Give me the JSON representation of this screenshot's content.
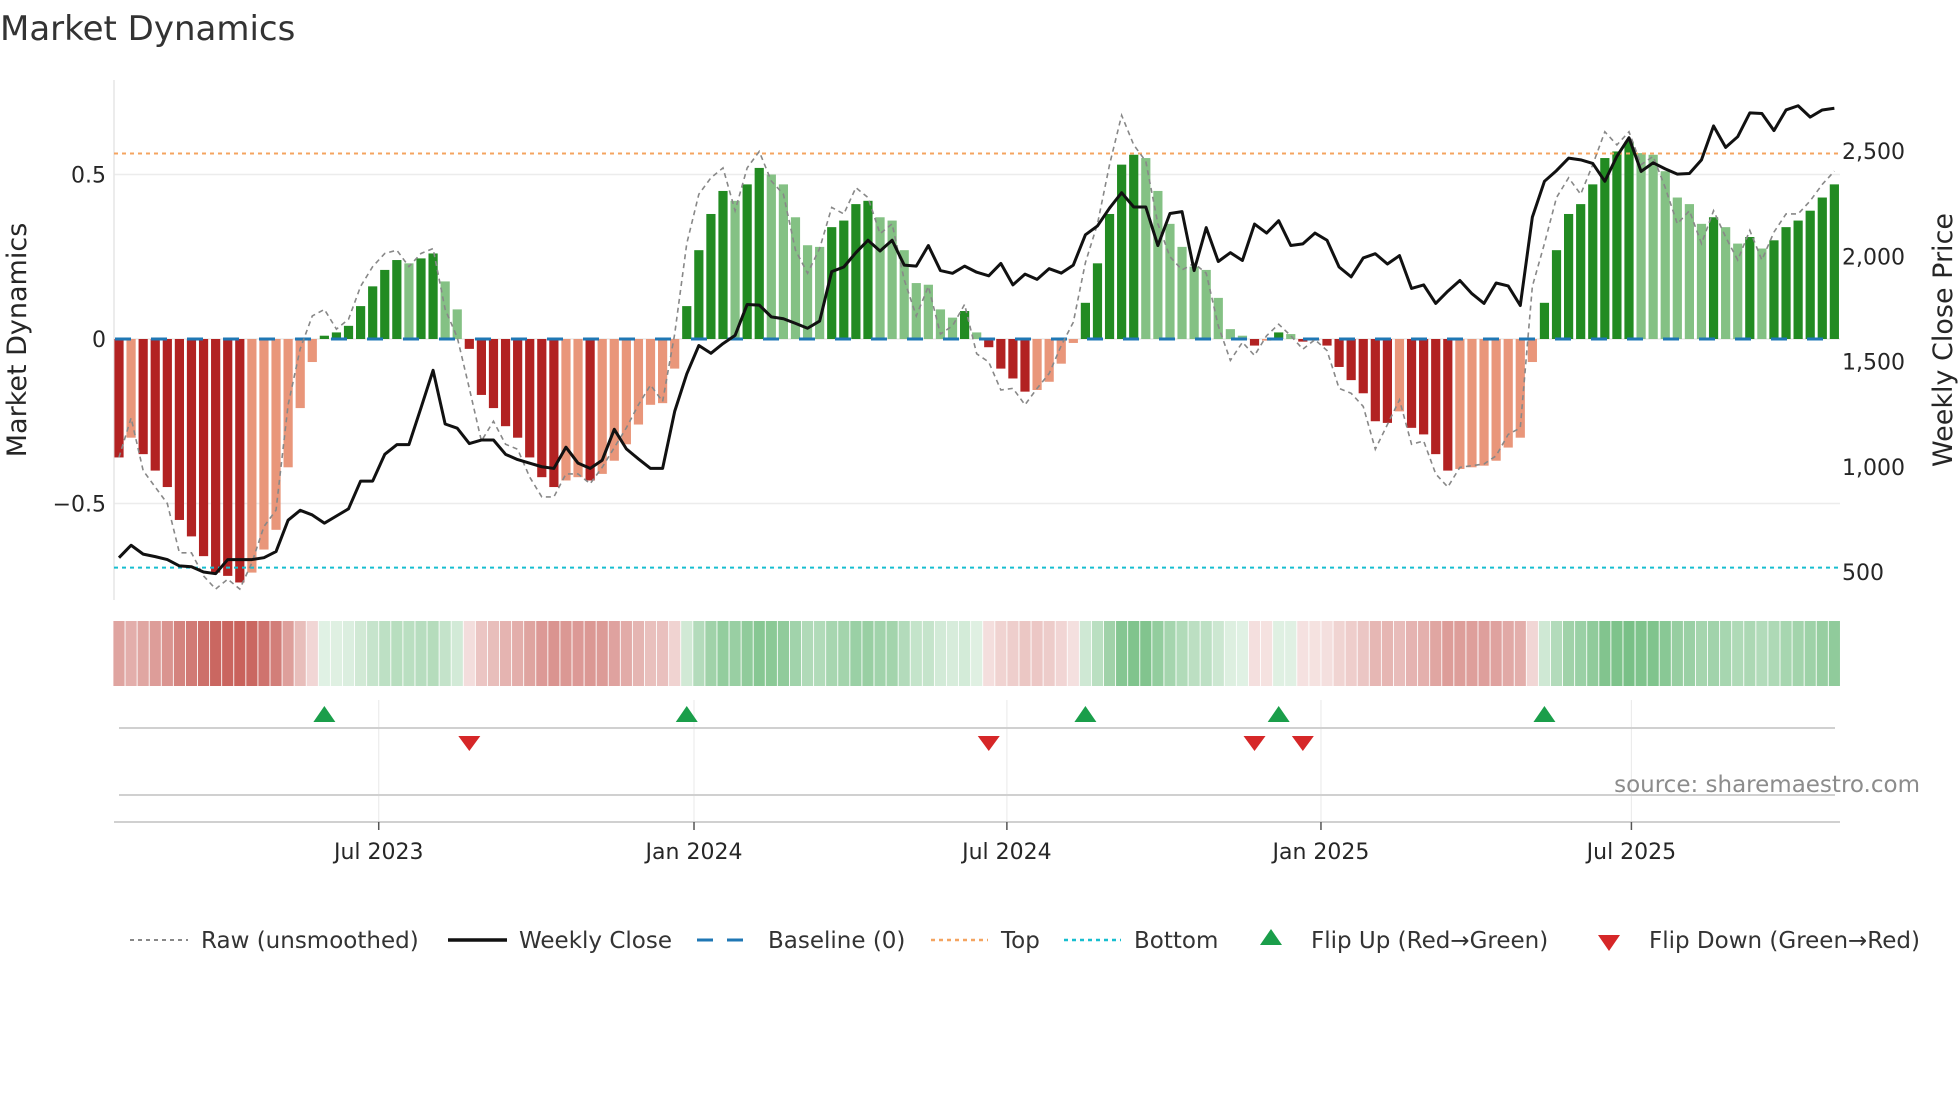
{
  "title": "Market Dynamics",
  "source": "source: sharemaestro.com",
  "colors": {
    "neg_strong": "#b22222",
    "neg_weak": "#e9967a",
    "pos_strong": "#228b22",
    "pos_weak": "#84c184",
    "close": "#111111",
    "raw": "#888888",
    "baseline": "#1f77b4",
    "top": "#f4a460",
    "bottom": "#17becf",
    "flip_up": "#1a9e4a",
    "flip_down": "#d62728"
  },
  "chart_data": {
    "type": "bar",
    "title": "Market Dynamics",
    "xlabel": "",
    "ylabel": "Market Dynamics",
    "ylabel_right": "Weekly Close Price",
    "ylim": [
      -0.79,
      0.79
    ],
    "ylim_right": [
      230,
      2900
    ],
    "x_unit": "week index",
    "x_ticks": [
      {
        "label": "Jul 2023",
        "x": 21.5
      },
      {
        "label": "Jan 2024",
        "x": 47.6
      },
      {
        "label": "Jul 2024",
        "x": 73.5
      },
      {
        "label": "Jan 2025",
        "x": 99.5
      },
      {
        "label": "Jul 2025",
        "x": 125.2
      }
    ],
    "y_ticks": [
      {
        "label": "0.5",
        "v": 0.5
      },
      {
        "label": "0",
        "v": 0
      },
      {
        "label": "−0.5",
        "v": -0.5
      }
    ],
    "y_ticks_right": [
      {
        "label": "2,500",
        "v": 2500
      },
      {
        "label": "2,000",
        "v": 2000
      },
      {
        "label": "1,500",
        "v": 1500
      },
      {
        "label": "1,000",
        "v": 1000
      },
      {
        "label": "500",
        "v": 500
      }
    ],
    "top_level": 0.564,
    "bottom_level": -0.695,
    "baseline": 0,
    "series": [
      {
        "name": "Market Dynamics (smoothed)",
        "values": [
          -0.36,
          -0.3,
          -0.35,
          -0.4,
          -0.45,
          -0.55,
          -0.6,
          -0.66,
          -0.71,
          -0.72,
          -0.74,
          -0.71,
          -0.64,
          -0.58,
          -0.39,
          -0.21,
          -0.07,
          0.01,
          0.02,
          0.04,
          0.1,
          0.16,
          0.21,
          0.24,
          0.23,
          0.245,
          0.26,
          0.175,
          0.09,
          -0.03,
          -0.17,
          -0.21,
          -0.265,
          -0.3,
          -0.36,
          -0.42,
          -0.45,
          -0.43,
          -0.42,
          -0.43,
          -0.41,
          -0.37,
          -0.32,
          -0.26,
          -0.2,
          -0.195,
          -0.09,
          0.1,
          0.27,
          0.38,
          0.45,
          0.42,
          0.47,
          0.52,
          0.5,
          0.47,
          0.37,
          0.285,
          0.28,
          0.34,
          0.36,
          0.41,
          0.42,
          0.37,
          0.36,
          0.27,
          0.17,
          0.165,
          0.09,
          0.065,
          0.085,
          0.02,
          -0.025,
          -0.09,
          -0.12,
          -0.16,
          -0.155,
          -0.13,
          -0.075,
          -0.012,
          0.11,
          0.23,
          0.38,
          0.53,
          0.56,
          0.55,
          0.45,
          0.35,
          0.28,
          0.22,
          0.21,
          0.125,
          0.03,
          0.01,
          -0.02,
          -0.005,
          0.02,
          0.015,
          -0.008,
          -0.005,
          -0.02,
          -0.085,
          -0.125,
          -0.165,
          -0.25,
          -0.255,
          -0.22,
          -0.27,
          -0.29,
          -0.35,
          -0.4,
          -0.395,
          -0.39,
          -0.385,
          -0.37,
          -0.33,
          -0.3,
          -0.07,
          0.11,
          0.27,
          0.38,
          0.41,
          0.47,
          0.55,
          0.57,
          0.6,
          0.565,
          0.56,
          0.51,
          0.43,
          0.41,
          0.35,
          0.37,
          0.34,
          0.29,
          0.31,
          0.275,
          0.3,
          0.34,
          0.36,
          0.39,
          0.43,
          0.47
        ]
      },
      {
        "name": "Raw (unsmoothed)",
        "values": [
          -0.36,
          -0.24,
          -0.4,
          -0.45,
          -0.5,
          -0.65,
          -0.65,
          -0.72,
          -0.76,
          -0.73,
          -0.76,
          -0.68,
          -0.57,
          -0.52,
          -0.2,
          -0.03,
          0.07,
          0.09,
          0.03,
          0.06,
          0.16,
          0.22,
          0.26,
          0.27,
          0.22,
          0.26,
          0.275,
          0.09,
          0.005,
          -0.15,
          -0.31,
          -0.25,
          -0.32,
          -0.335,
          -0.42,
          -0.48,
          -0.48,
          -0.41,
          -0.41,
          -0.44,
          -0.39,
          -0.33,
          -0.27,
          -0.2,
          -0.14,
          -0.19,
          0.015,
          0.29,
          0.44,
          0.49,
          0.52,
          0.39,
          0.52,
          0.57,
          0.48,
          0.44,
          0.27,
          0.2,
          0.275,
          0.4,
          0.38,
          0.46,
          0.43,
          0.32,
          0.35,
          0.18,
          0.07,
          0.16,
          0.015,
          0.04,
          0.105,
          -0.045,
          -0.07,
          -0.155,
          -0.15,
          -0.2,
          -0.15,
          -0.105,
          -0.02,
          0.051,
          0.232,
          0.35,
          0.53,
          0.68,
          0.59,
          0.54,
          0.35,
          0.25,
          0.21,
          0.23,
          0.2,
          0.04,
          -0.065,
          -0.01,
          -0.05,
          0.01,
          0.045,
          0.01,
          -0.031,
          -0.002,
          -0.035,
          -0.15,
          -0.165,
          -0.205,
          -0.335,
          -0.26,
          -0.185,
          -0.32,
          -0.31,
          -0.41,
          -0.45,
          -0.39,
          -0.385,
          -0.38,
          -0.355,
          -0.29,
          -0.27,
          0.16,
          0.29,
          0.43,
          0.49,
          0.44,
          0.53,
          0.63,
          0.59,
          0.63,
          0.53,
          0.555,
          0.46,
          0.35,
          0.39,
          0.29,
          0.39,
          0.31,
          0.24,
          0.33,
          0.24,
          0.325,
          0.38,
          0.38,
          0.42,
          0.47,
          0.51
        ]
      },
      {
        "name": "Weekly Close",
        "axis": "right",
        "values": [
          568,
          627,
          585,
          573,
          559,
          529,
          525,
          500,
          492,
          559,
          559,
          559,
          568,
          597,
          746,
          793,
          771,
          732,
          766,
          800,
          932,
          932,
          1059,
          1105,
          1105,
          1280,
          1458,
          1203,
          1183,
          1110,
          1127,
          1127,
          1059,
          1034,
          1017,
          1000,
          992,
          1093,
          1017,
          992,
          1031,
          1178,
          1085,
          1037,
          992,
          992,
          1263,
          1441,
          1576,
          1539,
          1585,
          1624,
          1771,
          1768,
          1712,
          1703,
          1681,
          1658,
          1692,
          1927,
          1949,
          2017,
          2076,
          2025,
          2076,
          1958,
          1953,
          2051,
          1932,
          1919,
          1953,
          1924,
          1907,
          1966,
          1864,
          1915,
          1890,
          1941,
          1920,
          1958,
          2102,
          2144,
          2229,
          2302,
          2234,
          2234,
          2051,
          2203,
          2212,
          1932,
          2136,
          1975,
          2017,
          1980,
          2153,
          2110,
          2169,
          2051,
          2059,
          2110,
          2076,
          1949,
          1902,
          1992,
          2012,
          1963,
          2003,
          1847,
          1864,
          1776,
          1834,
          1885,
          1822,
          1776,
          1873,
          1859,
          1766,
          2186,
          2356,
          2407,
          2466,
          2458,
          2441,
          2356,
          2475,
          2563,
          2403,
          2444,
          2415,
          2390,
          2393,
          2458,
          2619,
          2517,
          2568,
          2681,
          2678,
          2597,
          2695,
          2715,
          2661,
          2695,
          2703
        ]
      }
    ],
    "flip_up": [
      17,
      47,
      80,
      96,
      118
    ],
    "flip_down": [
      29,
      72,
      94,
      98
    ],
    "legend": {
      "placement": "bottom",
      "items": [
        "Raw (unsmoothed)",
        "Weekly Close",
        "Baseline (0)",
        "Top",
        "Bottom",
        "Flip Up (Red→Green)",
        "Flip Down (Green→Red)"
      ]
    }
  }
}
